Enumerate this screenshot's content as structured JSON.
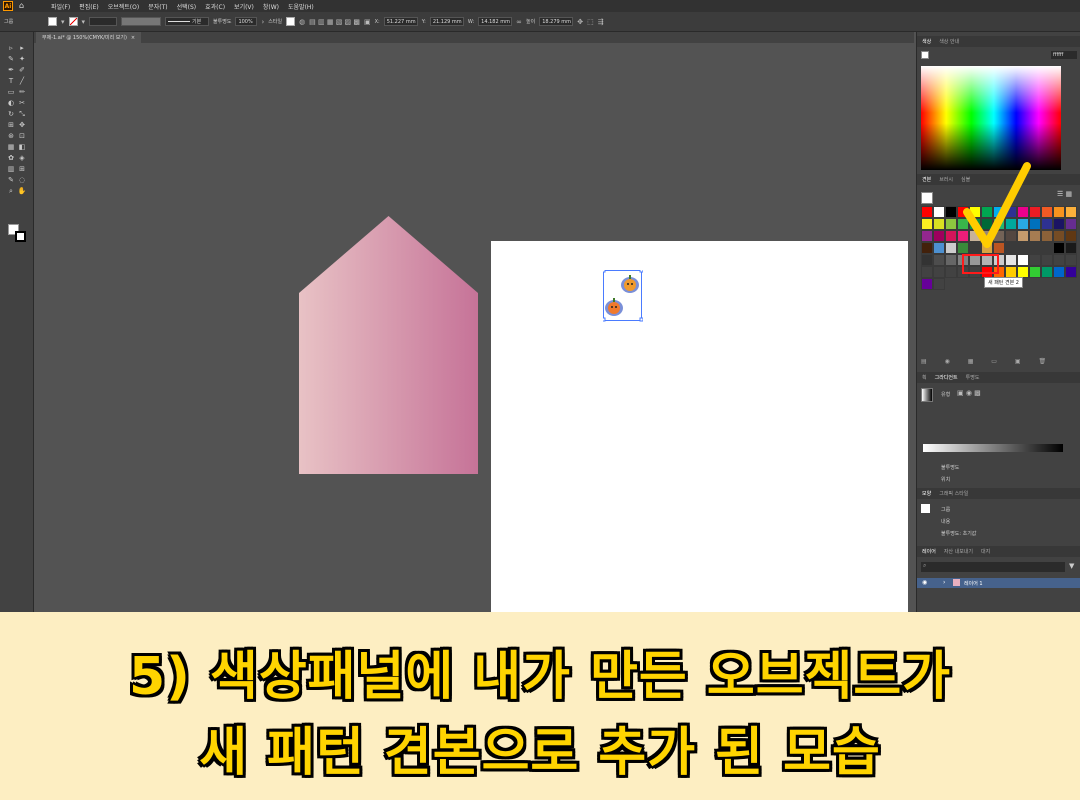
{
  "menubar": {
    "app_logo": "Ai",
    "items": [
      "파일(F)",
      "편집(E)",
      "오브젝트(O)",
      "문자(T)",
      "선택(S)",
      "효과(C)",
      "보기(V)",
      "창(W)",
      "도움말(H)"
    ]
  },
  "control_bar": {
    "selection_label": "그룹",
    "stroke_style": "기본",
    "opacity_label": "불투명도",
    "opacity_value": "100%",
    "style_label": "스타일",
    "x_value": "51.227 mm",
    "y_value": "21.129 mm",
    "w_value": "14.182 mm",
    "h_label": "높이",
    "h_value": "18.279 mm"
  },
  "document_tab": {
    "title": "무제-1.ai* @ 150%(CMYK/미리 보기)",
    "close": "×"
  },
  "color_panel": {
    "tabs": [
      "색상",
      "색상 안내"
    ],
    "hex_value": "ffffff"
  },
  "swatches_panel": {
    "tabs": [
      "견본",
      "브러시",
      "심볼"
    ],
    "tooltip": "새 패턴 견본 2"
  },
  "gradient_panel": {
    "tabs": [
      "획",
      "그라디언트",
      "투명도"
    ],
    "type_label": "유형",
    "opacity_label": "불투명도",
    "location_label": "위치"
  },
  "appearance_panel": {
    "tabs": [
      "모양",
      "그래픽 스타일"
    ],
    "rows": [
      "그룹",
      "내용",
      "불투명도: 초기값"
    ]
  },
  "layers_panel": {
    "tabs": [
      "레이어",
      "자산 내보내기",
      "대지"
    ],
    "layer_name": "레이어 1"
  },
  "caption": {
    "line1": "5) 색상패널에 내가 만든 오브젝트가",
    "line2": "새 패턴 견본으로 추가 된 모습"
  },
  "colors": {
    "house_left": "#e8c2c5",
    "house_right": "#c67398",
    "caption_fill": "#ffd400",
    "banner_bg": "#fdeec2",
    "highlight": "#ff1a1a",
    "checkmark": "#ffcc00"
  }
}
